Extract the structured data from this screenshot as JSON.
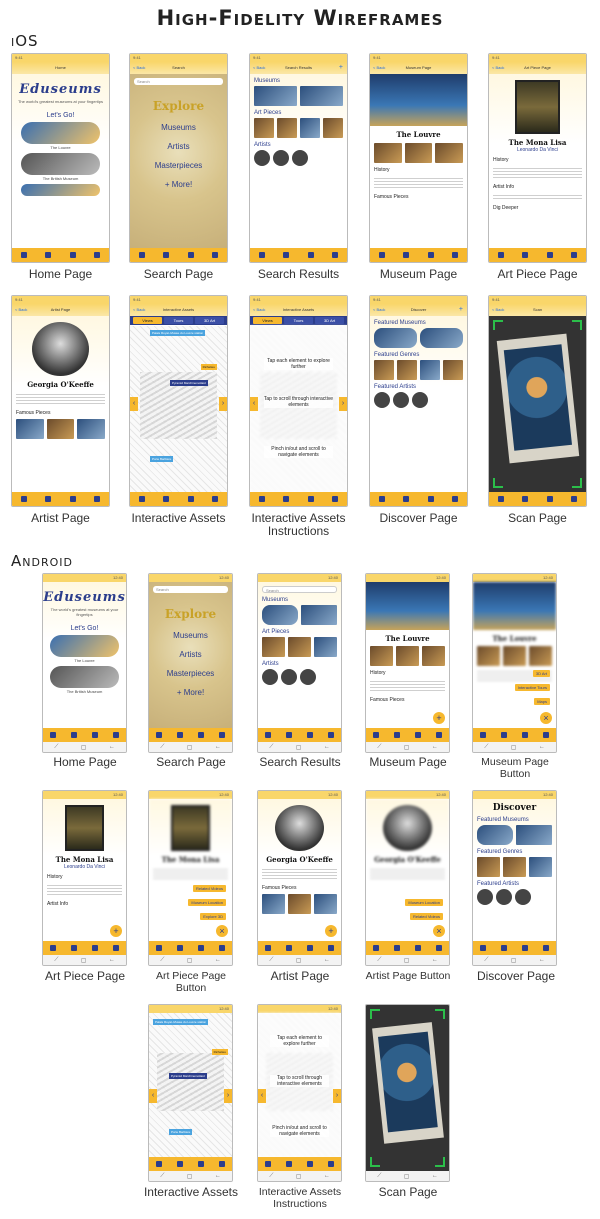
{
  "title": "High-Fidelity Wireframes",
  "sections": {
    "ios": "iOS",
    "android": "Android"
  },
  "common": {
    "time": "9:41",
    "android_time": "12:40",
    "back": "< Back",
    "logo": "Eduseums",
    "tagline": "The world's greatest museums at your fingertips",
    "lets_go": "Let's Go!",
    "the_louvre": "The Louvre",
    "british_museum": "The British Museum",
    "explore": "Explore",
    "museums": "Museums",
    "artists": "Artists",
    "masterpieces": "Masterpieces",
    "more": "+ More!",
    "search": "Search",
    "search_results": "Search Results",
    "art_pieces": "Art Pieces",
    "museum_page": "Museum Page",
    "art_piece_page": "Art Piece Page",
    "mona_lisa": "The Mona Lisa",
    "da_vinci": "Leonardo Da Vinci",
    "history": "History",
    "artist_info": "Artist Info",
    "dig_deeper": "Dig Deeper",
    "famous_pieces": "Famous Pieces",
    "artist_page": "Artist Page",
    "georgia": "Georgia O'Keeffe",
    "interactive_assets": "Interactive Assets",
    "tabs": [
      "Views",
      "Tours",
      "3D Art"
    ],
    "discover": "Discover",
    "featured_museums": "Featured Museums",
    "featured_genres": "Featured Genres",
    "featured_artists": "Featured Artists",
    "scan": "Scan",
    "instr1": "Tap each element to explore further",
    "instr2": "Tap to scroll through interactive elements",
    "instr3": "Pinch in/out and scroll to navigate elements",
    "interactive_tours": "Interactive Tours",
    "maps": "Maps",
    "related_videos": "Related Videos",
    "museum_location": "Museum Location",
    "explore_3d": "Explore 3D",
    "pyramid": "Pyramid Marchinemollaid",
    "porte": "Porte Barbière",
    "richelieu": "Richelieu",
    "palais": "Palais Royal–Musée du Louvre station"
  },
  "ios_captions": [
    "Home Page",
    "Search Page",
    "Search Results",
    "Museum Page",
    "Art Piece Page",
    "Artist Page",
    "Interactive Assets",
    "Interactive Assets Instructions",
    "Discover Page",
    "Scan Page"
  ],
  "android_captions": [
    "Home Page",
    "Search Page",
    "Search Results",
    "Museum Page",
    "Museum Page Button",
    "Art Piece Page",
    "Art Piece Page Button",
    "Artist Page",
    "Artist Page Button",
    "Discover Page",
    "Interactive Assets",
    "Interactive Assets Instructions",
    "Scan Page"
  ],
  "colors": {
    "accent": "#f6b82e",
    "navy": "#2b3d8c",
    "scan_green": "#2bbf4a"
  }
}
